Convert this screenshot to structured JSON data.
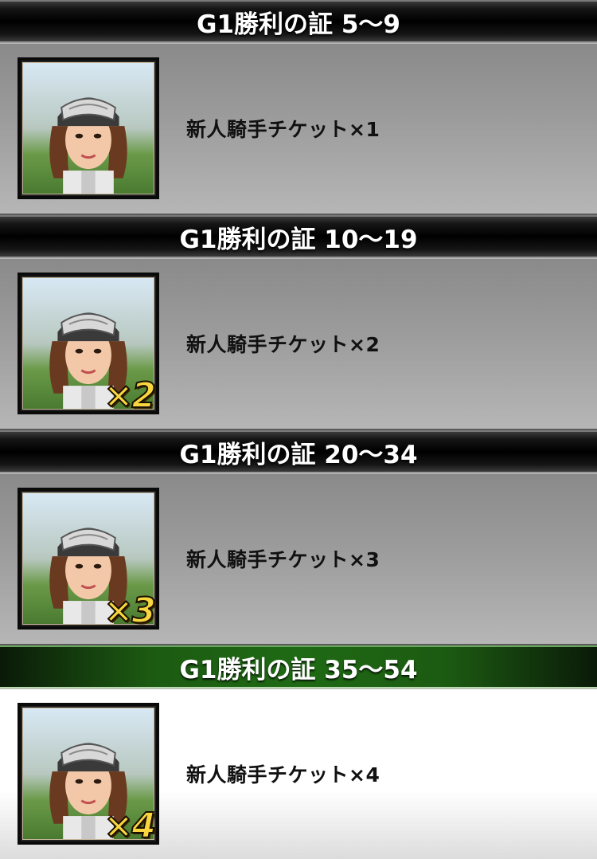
{
  "tiers": [
    {
      "title": "G1勝利の証 5〜9",
      "reward": "新人騎手チケット×1",
      "badge": "",
      "active": false,
      "icon": "jockey-portrait-icon"
    },
    {
      "title": "G1勝利の証 10〜19",
      "reward": "新人騎手チケット×2",
      "badge": "×2",
      "active": false,
      "icon": "jockey-portrait-icon"
    },
    {
      "title": "G1勝利の証 20〜34",
      "reward": "新人騎手チケット×3",
      "badge": "×3",
      "active": false,
      "icon": "jockey-portrait-icon"
    },
    {
      "title": "G1勝利の証 35〜54",
      "reward": "新人騎手チケット×4",
      "badge": "×4",
      "active": true,
      "icon": "jockey-portrait-icon"
    }
  ],
  "colors": {
    "header_dark": "#000000",
    "header_active": "#1f6a14",
    "body_gray": "#9c9c9c",
    "body_active": "#ffffff",
    "badge_gold": "#f8d640"
  }
}
